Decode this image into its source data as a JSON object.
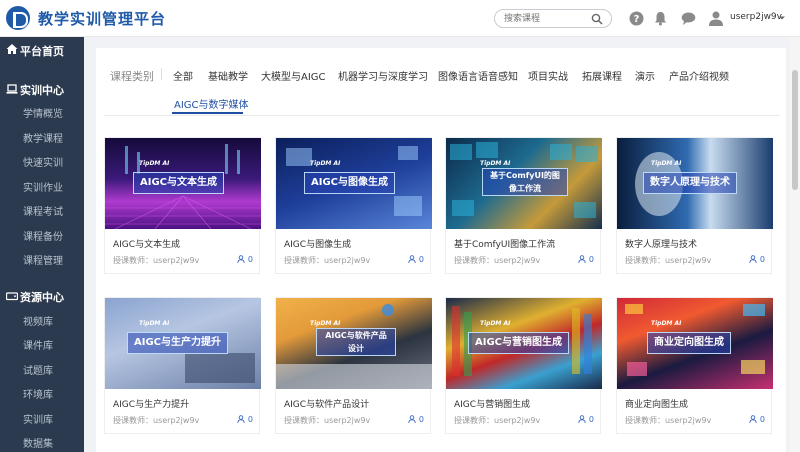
{
  "header": {
    "brand": "教学实训管理平台",
    "search_placeholder": "搜索课程",
    "username": "userp2jw9v"
  },
  "sidebar": {
    "home": "平台首页",
    "sections": [
      {
        "title": "实训中心",
        "icon": "laptop-icon",
        "items": [
          "学情概览",
          "教学课程",
          "快速实训",
          "实训作业",
          "课程考试",
          "课程备份",
          "课程管理"
        ]
      },
      {
        "title": "资源中心",
        "icon": "drive-icon",
        "items": [
          "视频库",
          "课件库",
          "试题库",
          "环境库",
          "实训库",
          "数据集"
        ]
      }
    ]
  },
  "categories": {
    "label": "课程类别",
    "items": [
      "全部",
      "基础教学",
      "大模型与AIGC",
      "机器学习与深度学习",
      "图像语言语音感知",
      "项目实战",
      "拓展课程",
      "演示",
      "产品介绍视频"
    ],
    "active": "AIGC与数字媒体"
  },
  "cards": [
    {
      "title": "AIGC与文本生成",
      "banner": "AIGC与文本生成",
      "tag": "TipDM AI",
      "teacher": "授课教师：userp2jw9v",
      "count": "0"
    },
    {
      "title": "AIGC与图像生成",
      "banner": "AIGC与图像生成",
      "tag": "TipDM AI",
      "teacher": "授课教师：userp2jw9v",
      "count": "0"
    },
    {
      "title": "基于ComfyUI图像工作流",
      "banner": "基于ComfyUI的图像工作流",
      "tag": "TipDM AI",
      "teacher": "授课教师：userp2jw9v",
      "count": "0"
    },
    {
      "title": "数字人原理与技术",
      "banner": "数字人原理与技术",
      "tag": "TipDM AI",
      "teacher": "授课教师：userp2jw9v",
      "count": "0"
    },
    {
      "title": "AIGC与生产力提升",
      "banner": "AIGC与生产力提升",
      "tag": "TipDM AI",
      "teacher": "授课教师：userp2jw9v",
      "count": "0"
    },
    {
      "title": "AIGC与软件产品设计",
      "banner": "AIGC与软件产品设计",
      "tag": "TipDM AI",
      "teacher": "授课教师：userp2jw9v",
      "count": "0"
    },
    {
      "title": "AIGC与营销图生成",
      "banner": "AIGC与营销图生成",
      "tag": "TipDM AI",
      "teacher": "授课教师：userp2jw9v",
      "count": "0"
    },
    {
      "title": "商业定向图生成",
      "banner": "商业定向图生成",
      "tag": "TipDM AI",
      "teacher": "授课教师：userp2jw9v",
      "count": "0"
    }
  ],
  "colors": {
    "primary": "#1f4fa3",
    "sidebar": "#2b3a4e"
  }
}
